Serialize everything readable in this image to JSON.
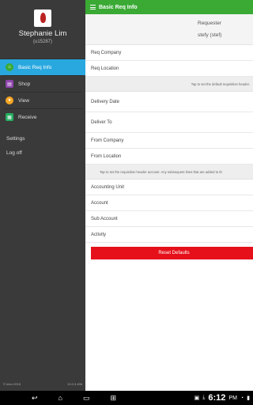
{
  "drawer": {
    "user_name": "Stephanie Lim",
    "user_id": "(u15287)",
    "nav_items": [
      {
        "label": "Basic Req Info",
        "icon": "home-icon",
        "color": "#3aaa35",
        "active": true
      },
      {
        "label": "Shop",
        "icon": "shop-icon",
        "color": "#8e44ad"
      },
      {
        "label": "View",
        "icon": "location-icon",
        "color": "#f5a623"
      },
      {
        "label": "Receive",
        "icon": "receive-icon",
        "color": "#27ae60"
      }
    ],
    "extra_items": [
      "Settings",
      "Log off"
    ],
    "footer_left": "© Infor 2015",
    "footer_right": "10.0.3.496"
  },
  "topbar": {
    "title": "Basic Req Info"
  },
  "requester": {
    "label": "Requester",
    "value": "stefy (stef)"
  },
  "fields": {
    "req_company": "Req Company",
    "req_location": "Req Location",
    "hint_default_header": "Tap to set the default requisition header.",
    "delivery_date": "Delivery Date",
    "deliver_to": "Deliver To",
    "from_company": "From Company",
    "from_location": "From Location",
    "hint_account": "Tap to set the requisition header account. Any subsequent lines that are added to th",
    "accounting_unit": "Accounting Unit",
    "account": "Account",
    "sub_account": "Sub Account",
    "activity": "Activity"
  },
  "reset_button": "Reset Defaults",
  "statusbar": {
    "time": "6:12",
    "period": "PM"
  }
}
